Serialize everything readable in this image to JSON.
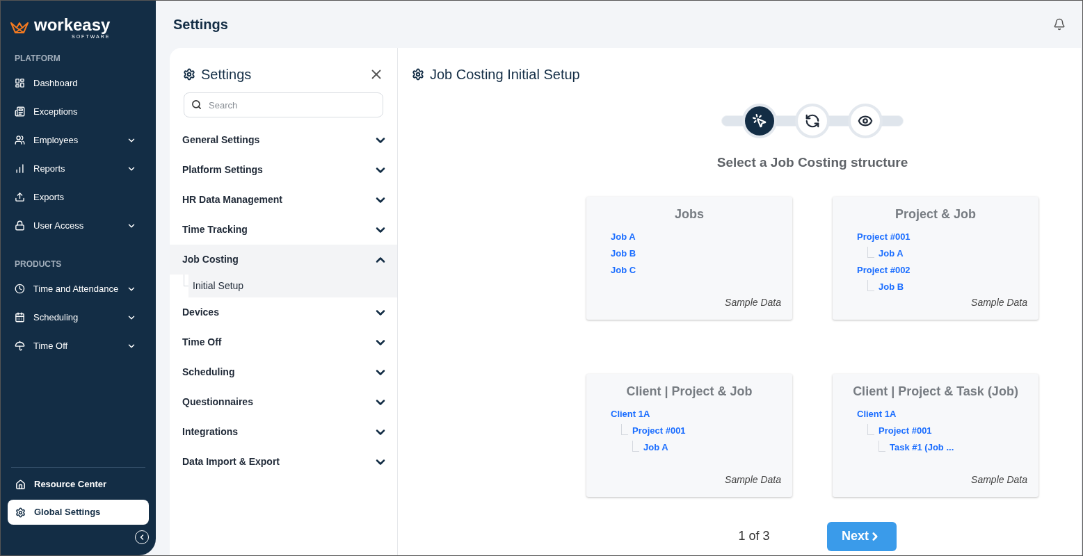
{
  "brand": {
    "name": "workeasy",
    "tagline": "SOFTWARE"
  },
  "sidebar": {
    "sections": [
      {
        "heading": "PLATFORM",
        "items": [
          {
            "label": "Dashboard",
            "expandable": false
          },
          {
            "label": "Exceptions",
            "expandable": false
          },
          {
            "label": "Employees",
            "expandable": true
          },
          {
            "label": "Reports",
            "expandable": true
          },
          {
            "label": "Exports",
            "expandable": false
          },
          {
            "label": "User Access",
            "expandable": true
          }
        ]
      },
      {
        "heading": "PRODUCTS",
        "items": [
          {
            "label": "Time and Attendance",
            "expandable": true
          },
          {
            "label": "Scheduling",
            "expandable": true
          },
          {
            "label": "Time Off",
            "expandable": true
          }
        ]
      }
    ],
    "footer_items": [
      {
        "label": "Resource Center",
        "selected": false
      },
      {
        "label": "Global Settings",
        "selected": true
      }
    ]
  },
  "page_title": "Settings",
  "settings_nav": {
    "title": "Settings",
    "search": {
      "placeholder": "Search"
    },
    "groups": [
      {
        "label": "General Settings",
        "expanded": false
      },
      {
        "label": "Platform Settings",
        "expanded": false
      },
      {
        "label": "HR Data Management",
        "expanded": false
      },
      {
        "label": "Time Tracking",
        "expanded": false
      },
      {
        "label": "Job Costing",
        "expanded": true,
        "children": [
          {
            "label": "Initial Setup",
            "selected": true
          }
        ]
      },
      {
        "label": "Devices",
        "expanded": false
      },
      {
        "label": "Time Off",
        "expanded": false
      },
      {
        "label": "Scheduling",
        "expanded": false
      },
      {
        "label": "Questionnaires",
        "expanded": false
      },
      {
        "label": "Integrations",
        "expanded": false
      },
      {
        "label": "Data Import & Export",
        "expanded": false
      }
    ]
  },
  "setup": {
    "title": "Job Costing Initial Setup",
    "steps": [
      {
        "selected": true
      },
      {
        "selected": false
      },
      {
        "selected": false
      }
    ],
    "step_label": "Select a Job Costing structure",
    "cards": [
      {
        "title": "Jobs",
        "items": [
          {
            "label": "Job A"
          },
          {
            "label": "Job B"
          },
          {
            "label": "Job C"
          }
        ],
        "footnote": "Sample Data"
      },
      {
        "title": "Project & Job",
        "items": [
          {
            "label": "Project #001",
            "children": [
              {
                "label": "Job A"
              }
            ]
          },
          {
            "label": "Project #002",
            "children": [
              {
                "label": "Job B"
              }
            ]
          }
        ],
        "footnote": "Sample Data"
      },
      {
        "title": "Client | Project & Job",
        "items": [
          {
            "label": "Client 1A",
            "children": [
              {
                "label": "Project #001",
                "children": [
                  {
                    "label": "Job A"
                  }
                ]
              }
            ]
          }
        ],
        "footnote": "Sample Data"
      },
      {
        "title": "Client | Project & Task (Job)",
        "items": [
          {
            "label": "Client 1A",
            "children": [
              {
                "label": "Project #001",
                "children": [
                  {
                    "label": "Task #1 (Job ..."
                  }
                ]
              }
            ]
          }
        ],
        "footnote": "Sample Data"
      }
    ],
    "pager": "1 of 3",
    "next": "Next"
  }
}
